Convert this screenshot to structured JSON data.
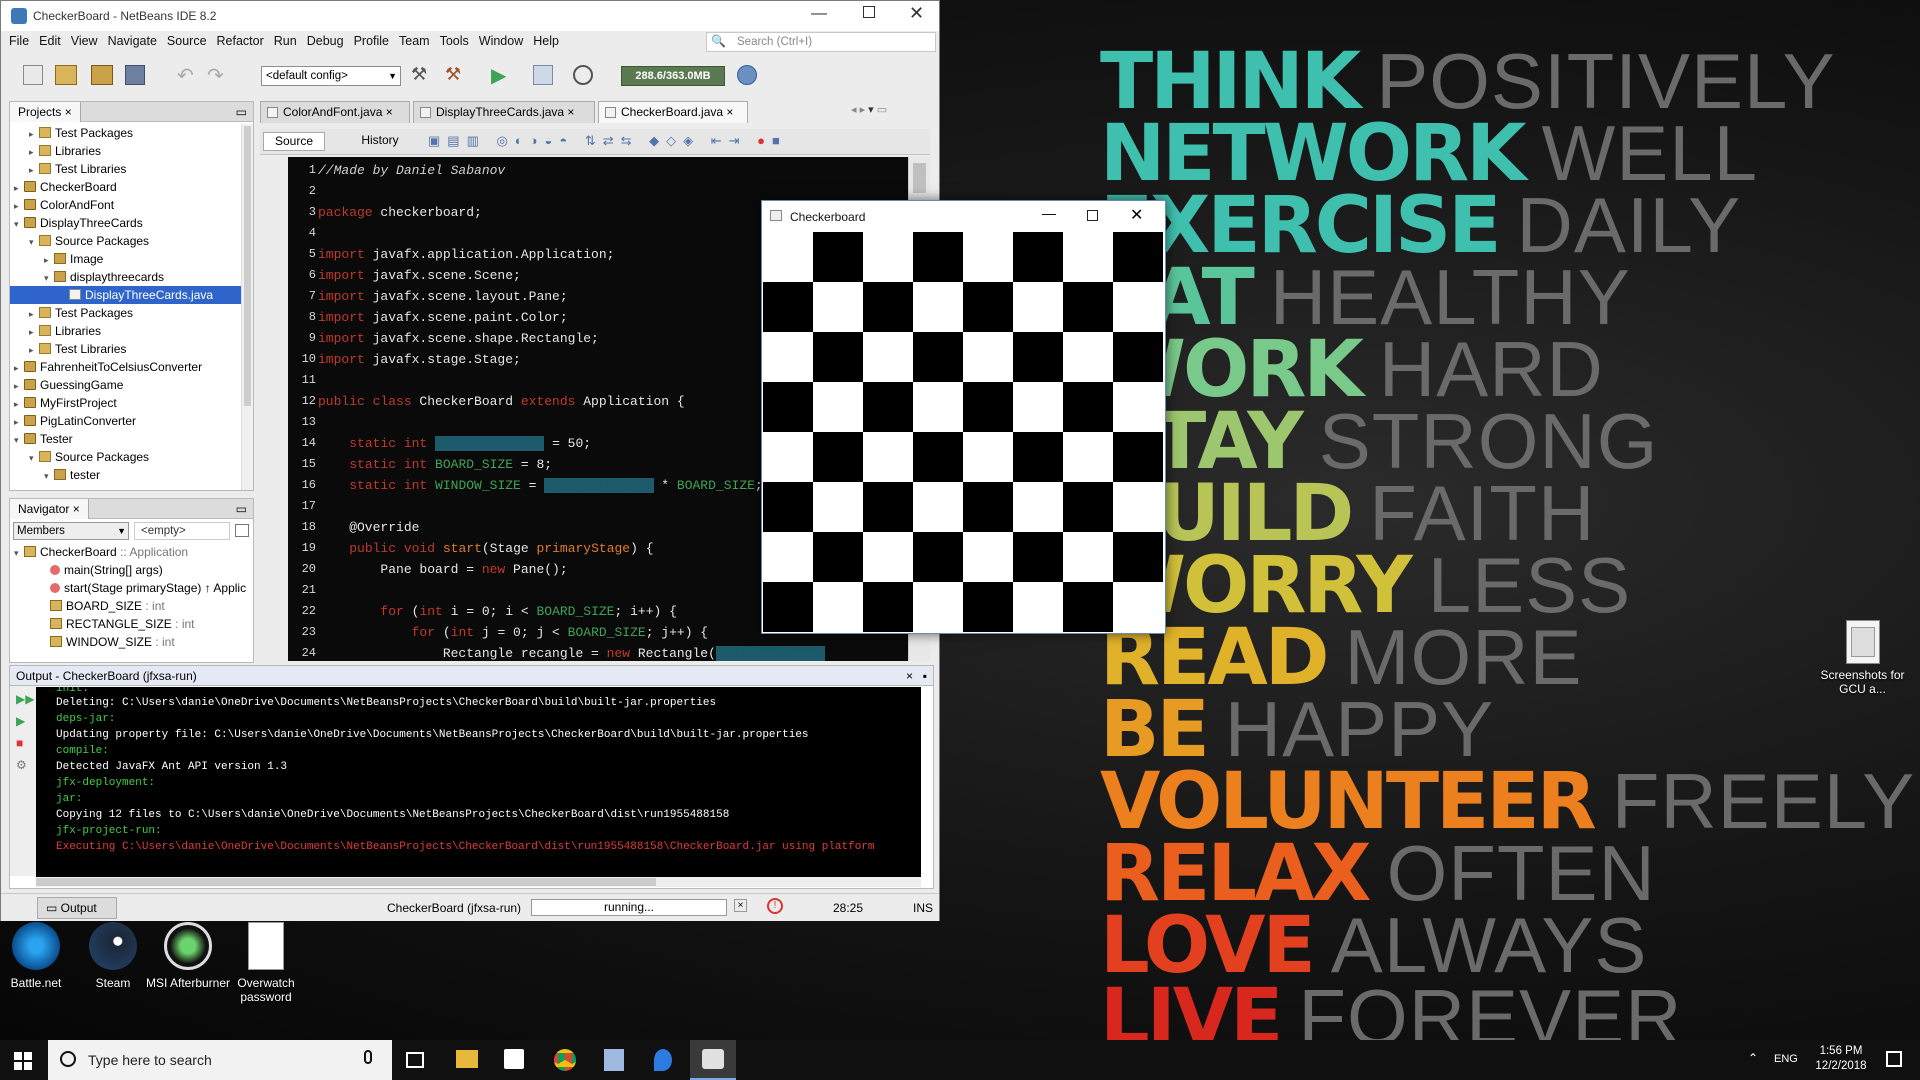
{
  "wallpaper": {
    "lines": [
      {
        "bold": "THINK",
        "thin": "POSITIVELY",
        "color": "#3fbfae"
      },
      {
        "bold": "NETWORK",
        "thin": "WELL",
        "color": "#3fbfae"
      },
      {
        "bold": "EXERCISE",
        "thin": "DAILY",
        "color": "#3fbfae"
      },
      {
        "bold": "EAT",
        "thin": "HEALTHY",
        "color": "#5ac49a"
      },
      {
        "bold": "WORK",
        "thin": "HARD",
        "color": "#79c98a"
      },
      {
        "bold": "STAY",
        "thin": "STRONG",
        "color": "#9cc76e"
      },
      {
        "bold": "BUILD",
        "thin": "FAITH",
        "color": "#b8c456"
      },
      {
        "bold": "WORRY",
        "thin": "LESS",
        "color": "#d0c03a"
      },
      {
        "bold": "READ",
        "thin": "MORE",
        "color": "#e0b22a"
      },
      {
        "bold": "BE",
        "thin": "HAPPY",
        "color": "#e89b22"
      },
      {
        "bold": "VOLUNTEER",
        "thin": "FREELY",
        "color": "#ec7f1e"
      },
      {
        "bold": "RELAX",
        "thin": "OFTEN",
        "color": "#ea5e1e"
      },
      {
        "bold": "LOVE",
        "thin": "ALWAYS",
        "color": "#e2401e"
      },
      {
        "bold": "LIVE",
        "thin": "FOREVER",
        "color": "#d8281e"
      }
    ]
  },
  "desktop": {
    "icons": [
      {
        "label": "Battle.net",
        "name": "battlenet-icon"
      },
      {
        "label": "Steam",
        "name": "steam-icon"
      },
      {
        "label": "MSI Afterburner",
        "name": "msi-afterburner-icon"
      },
      {
        "label": "Overwatch password",
        "name": "text-file-icon"
      }
    ],
    "right_icon": {
      "label": "Screenshots for GCU a..."
    }
  },
  "taskbar": {
    "search_placeholder": "Type here to search",
    "lang": "ENG",
    "time": "1:56 PM",
    "date": "12/2/2018"
  },
  "netbeans": {
    "title": "CheckerBoard - NetBeans IDE 8.2",
    "menu": [
      "File",
      "Edit",
      "View",
      "Navigate",
      "Source",
      "Refactor",
      "Run",
      "Debug",
      "Profile",
      "Team",
      "Tools",
      "Window",
      "Help"
    ],
    "search_placeholder": "Search (Ctrl+I)",
    "config": "<default config>",
    "memory": "288.6/363.0MB",
    "projects_tab": "Projects",
    "tree": [
      {
        "indent": 2,
        "tw": "▸",
        "icon": "fold",
        "text": "Test Packages"
      },
      {
        "indent": 2,
        "tw": "▸",
        "icon": "fold",
        "text": "Libraries"
      },
      {
        "indent": 2,
        "tw": "▸",
        "icon": "fold",
        "text": "Test Libraries"
      },
      {
        "indent": 1,
        "tw": "▸",
        "icon": "proj",
        "text": "CheckerBoard"
      },
      {
        "indent": 1,
        "tw": "▸",
        "icon": "proj",
        "text": "ColorAndFont"
      },
      {
        "indent": 1,
        "tw": "▾",
        "icon": "proj",
        "text": "DisplayThreeCards"
      },
      {
        "indent": 2,
        "tw": "▾",
        "icon": "fold",
        "text": "Source Packages"
      },
      {
        "indent": 3,
        "tw": "▸",
        "icon": "pkg",
        "text": "Image"
      },
      {
        "indent": 3,
        "tw": "▾",
        "icon": "pkg",
        "text": "displaythreecards"
      },
      {
        "indent": 4,
        "tw": "",
        "icon": "file",
        "text": "DisplayThreeCards.java",
        "selected": true
      },
      {
        "indent": 2,
        "tw": "▸",
        "icon": "fold",
        "text": "Test Packages"
      },
      {
        "indent": 2,
        "tw": "▸",
        "icon": "fold",
        "text": "Libraries"
      },
      {
        "indent": 2,
        "tw": "▸",
        "icon": "fold",
        "text": "Test Libraries"
      },
      {
        "indent": 1,
        "tw": "▸",
        "icon": "proj",
        "text": "FahrenheitToCelsiusConverter"
      },
      {
        "indent": 1,
        "tw": "▸",
        "icon": "proj",
        "text": "GuessingGame"
      },
      {
        "indent": 1,
        "tw": "▸",
        "icon": "proj",
        "text": "MyFirstProject"
      },
      {
        "indent": 1,
        "tw": "▸",
        "icon": "proj",
        "text": "PigLatinConverter"
      },
      {
        "indent": 1,
        "tw": "▾",
        "icon": "proj",
        "text": "Tester"
      },
      {
        "indent": 2,
        "tw": "▾",
        "icon": "fold",
        "text": "Source Packages"
      },
      {
        "indent": 3,
        "tw": "▾",
        "icon": "pkg",
        "text": "tester"
      }
    ],
    "navigator_tab": "Navigator",
    "members_label": "Members",
    "members_filter": "<empty>",
    "nav_items": [
      {
        "text": "CheckerBoard",
        "suffix": " :: Application",
        "type": "class"
      },
      {
        "text": "main(String[] args)",
        "suffix": "",
        "type": "method"
      },
      {
        "text": "start(Stage primaryStage) ↑ Applic",
        "suffix": "",
        "type": "method"
      },
      {
        "text": "BOARD_SIZE",
        "suffix": " : int",
        "type": "field"
      },
      {
        "text": "RECTANGLE_SIZE",
        "suffix": " : int",
        "type": "field"
      },
      {
        "text": "WINDOW_SIZE",
        "suffix": " : int",
        "type": "field"
      }
    ],
    "editor_tabs": [
      "ColorAndFont.java",
      "DisplayThreeCards.java",
      "CheckerBoard.java"
    ],
    "source_btn": "Source",
    "history_btn": "History",
    "code_lines": [
      {
        "n": "1",
        "html": "<span class='cm'>//Made by Daniel Sabanov</span>"
      },
      {
        "n": "2",
        "html": ""
      },
      {
        "n": "3",
        "html": "<span class='kw'>package</span> checkerboard;"
      },
      {
        "n": "4",
        "html": ""
      },
      {
        "n": "5",
        "html": "<span class='kw'>import</span> javafx.application.Application;"
      },
      {
        "n": "6",
        "html": "<span class='kw'>import</span> javafx.scene.Scene;"
      },
      {
        "n": "7",
        "html": "<span class='kw'>import</span> javafx.scene.layout.Pane;"
      },
      {
        "n": "8",
        "html": "<span class='kw'>import</span> javafx.scene.paint.Color;"
      },
      {
        "n": "9",
        "html": "<span class='kw'>import</span> javafx.scene.shape.Rectangle;"
      },
      {
        "n": "10",
        "html": "<span class='kw'>import</span> javafx.stage.Stage;"
      },
      {
        "n": "11",
        "html": ""
      },
      {
        "n": "12",
        "html": "<span class='kw'>public class</span> CheckerBoard <span class='kw'>extends</span> Application {"
      },
      {
        "n": "13",
        "html": ""
      },
      {
        "n": "14",
        "html": "    <span class='kw'>static int</span> <span class='hl'>RECTANGLE_SIZE</span> = 50;"
      },
      {
        "n": "15",
        "html": "    <span class='kw'>static int</span> <span class='fld'>BOARD_SIZE</span> = 8;"
      },
      {
        "n": "16",
        "html": "    <span class='kw'>static int</span> <span class='fld'>WINDOW_SIZE</span> = <span class='hl'>RECTANGLE_SIZE</span> * <span class='fld'>BOARD_SIZE</span>;"
      },
      {
        "n": "17",
        "html": ""
      },
      {
        "n": "18",
        "html": "    @Override"
      },
      {
        "n": "19",
        "html": "    <span class='kw'>public void</span> <span style='color:#e07b2e'>start</span>(Stage <span style='color:#e07b2e'>primaryStage</span>) {"
      },
      {
        "n": "20",
        "html": "        Pane board = <span class='kw'>new</span> Pane();"
      },
      {
        "n": "21",
        "html": ""
      },
      {
        "n": "22",
        "html": "        <span class='kw'>for</span> (<span class='kw'>int</span> i = 0; i &lt; <span class='fld'>BOARD_SIZE</span>; i++) {"
      },
      {
        "n": "23",
        "html": "            <span class='kw'>for</span> (<span class='kw'>int</span> j = 0; j &lt; <span class='fld'>BOARD_SIZE</span>; j++) {"
      },
      {
        "n": "24",
        "html": "                Rectangle recangle = <span class='kw'>new</span> Rectangle(<span class='hl'>RECTANGLE_SIZE</span>"
      }
    ],
    "output_title": "Output - CheckerBoard (jfxsa-run)",
    "output_lines": [
      {
        "c": "og",
        "t": "init:"
      },
      {
        "c": "ow",
        "t": "Deleting: C:\\Users\\danie\\OneDrive\\Documents\\NetBeansProjects\\CheckerBoard\\build\\built-jar.properties"
      },
      {
        "c": "og",
        "t": "deps-jar:"
      },
      {
        "c": "ow",
        "t": "Updating property file: C:\\Users\\danie\\OneDrive\\Documents\\NetBeansProjects\\CheckerBoard\\build\\built-jar.properties"
      },
      {
        "c": "og",
        "t": "compile:"
      },
      {
        "c": "ow",
        "t": "Detected JavaFX Ant API version 1.3"
      },
      {
        "c": "og",
        "t": "jfx-deployment:"
      },
      {
        "c": "og",
        "t": "jar:"
      },
      {
        "c": "ow",
        "t": "Copying 12 files to C:\\Users\\danie\\OneDrive\\Documents\\NetBeansProjects\\CheckerBoard\\dist\\run1955488158"
      },
      {
        "c": "og",
        "t": "jfx-project-run:"
      },
      {
        "c": "or",
        "t": "Executing C:\\Users\\danie\\OneDrive\\Documents\\NetBeansProjects\\CheckerBoard\\dist\\run1955488158\\CheckerBoard.jar using platform"
      }
    ],
    "output_tab": "Output",
    "status_project": "CheckerBoard (jfxsa-run)",
    "status_running": "running...",
    "status_pos": "28:25",
    "status_mode": "INS"
  },
  "checkerboard": {
    "title": "Checkerboard",
    "size": 8,
    "dark": "#000000",
    "light": "#ffffff"
  }
}
